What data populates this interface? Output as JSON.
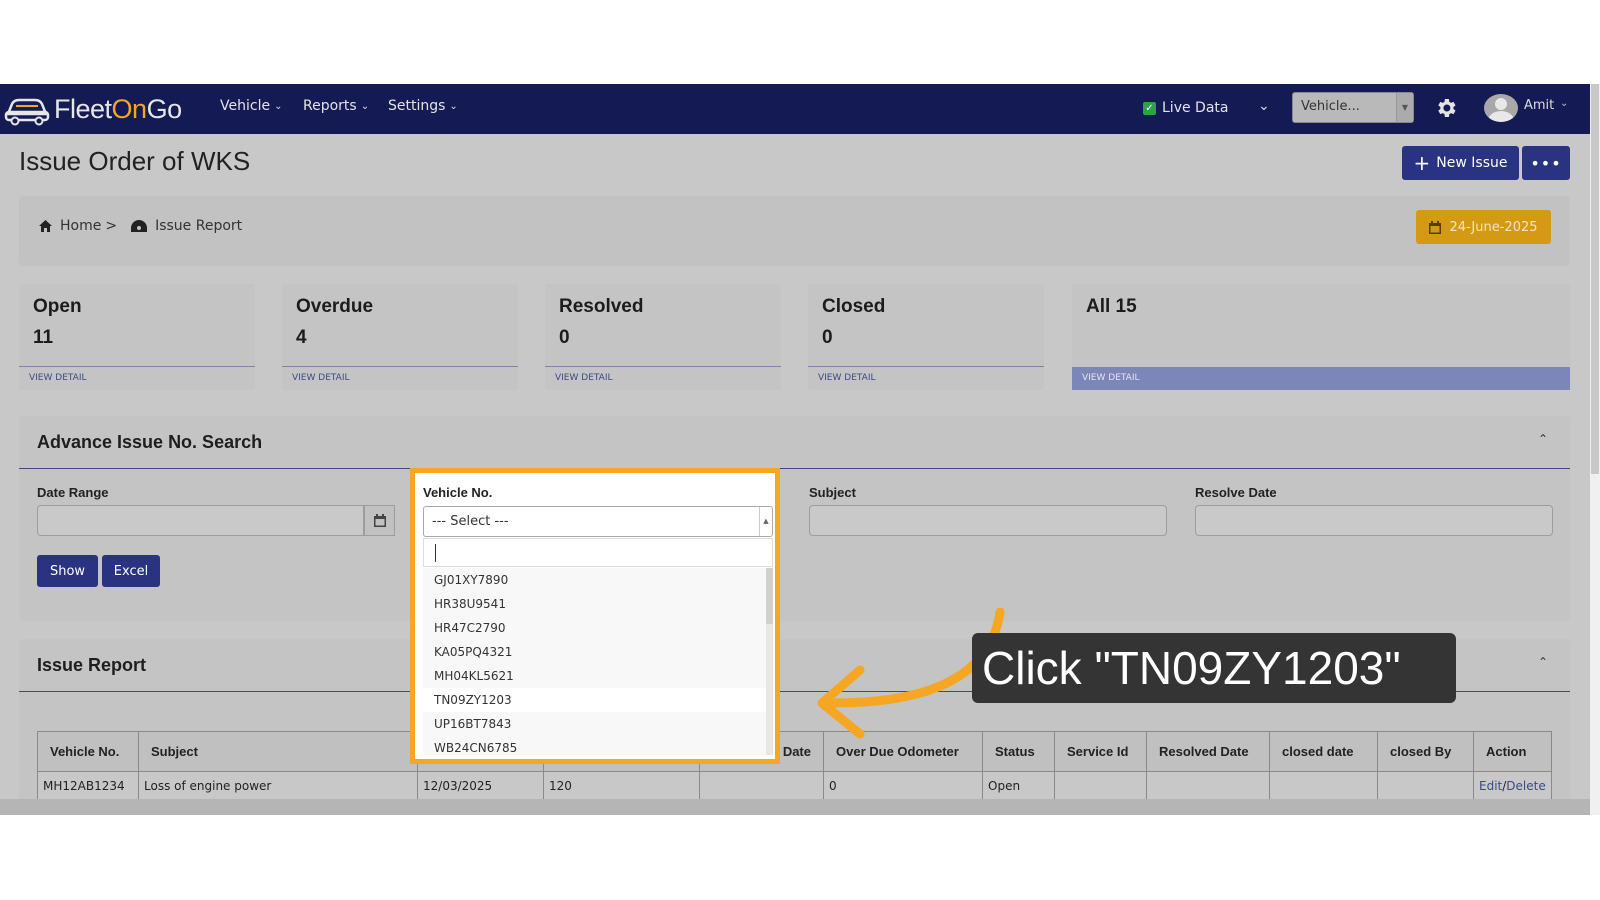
{
  "nav": {
    "logo_parts": [
      "Fleet",
      "On",
      "Go"
    ],
    "menus": [
      {
        "label": "Vehicle"
      },
      {
        "label": "Reports"
      },
      {
        "label": "Settings"
      }
    ],
    "live_data_label": "Live Data",
    "live_data_checked": true,
    "vehicle_select_value": "Vehicle...",
    "user_name": "Amit"
  },
  "page": {
    "title": "Issue Order of WKS",
    "new_issue_label": "New Issue",
    "more_label": "•••"
  },
  "breadcrumb": {
    "home": "Home",
    "separator": ">",
    "current": "Issue Report",
    "date": "24-June-2025"
  },
  "stats": [
    {
      "label": "Open",
      "count": "11",
      "link": "VIEW DETAIL"
    },
    {
      "label": "Overdue",
      "count": "4",
      "link": "VIEW DETAIL"
    },
    {
      "label": "Resolved",
      "count": "0",
      "link": "VIEW DETAIL"
    },
    {
      "label": "Closed",
      "count": "0",
      "link": "VIEW DETAIL"
    },
    {
      "label": "All 15",
      "count": "",
      "link": "VIEW DETAIL"
    }
  ],
  "search_panel": {
    "title": "Advance Issue No. Search",
    "date_range_label": "Date Range",
    "subject_label": "Subject",
    "resolve_date_label": "Resolve Date",
    "show_label": "Show",
    "excel_label": "Excel"
  },
  "vehicle_dropdown": {
    "label": "Vehicle No.",
    "selected": "--- Select ---",
    "search_value": "",
    "options": [
      "GJ01XY7890",
      "HR38U9541",
      "HR47C2790",
      "KA05PQ4321",
      "MH04KL5621",
      "TN09ZY1203",
      "UP16BT7843",
      "WB24CN6785"
    ],
    "highlighted": "TN09ZY1203"
  },
  "report_panel": {
    "title": "Issue Report",
    "columns": [
      "Vehicle No.",
      "Subject",
      "",
      "",
      "Date",
      "Over Due Odometer",
      "Status",
      "Service Id",
      "Resolved Date",
      "closed date",
      "closed By",
      "Action"
    ],
    "rows": [
      {
        "vehicle": "MH12AB1234",
        "subject": "Loss of engine power",
        "date": "12/03/2025",
        "odometer": "120",
        "due_date": "",
        "over_due_odometer": "0",
        "status": "Open",
        "service_id": "",
        "resolved_date": "",
        "closed_date": "",
        "closed_by": "",
        "edit": "Edit",
        "action_sep": "/",
        "delete": "Delete"
      }
    ]
  },
  "callout": {
    "text": "Click \"TN09ZY1203\""
  },
  "colors": {
    "nav_bg": "#141b54",
    "accent_orange": "#f5a623",
    "button_navy": "#2a3382",
    "date_button": "#d49a13"
  }
}
